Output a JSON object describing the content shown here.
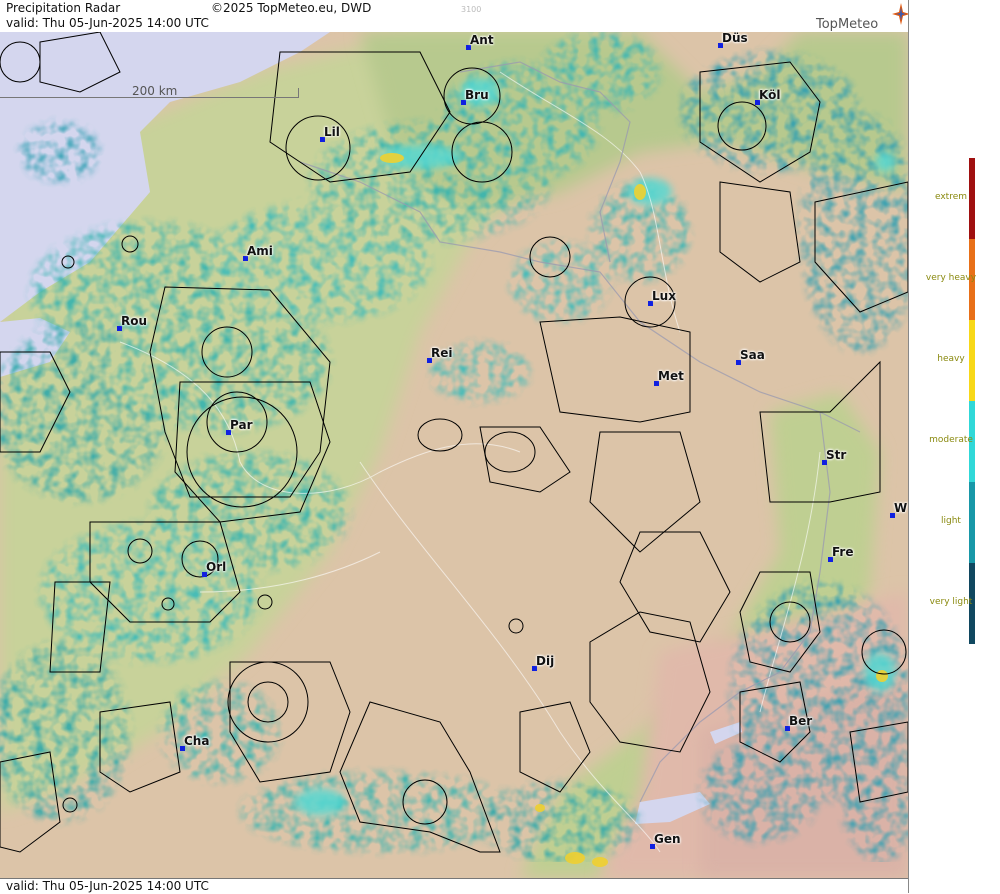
{
  "header": {
    "title": "Precipitation Radar",
    "copyright": "©2025 TopMeteo.eu, DWD",
    "valid": "valid:  Thu  05-Jun-2025 14:00 UTC",
    "faint_number": "3100"
  },
  "footer": {
    "valid": "valid:  Thu  05-Jun-2025 14:00 UTC"
  },
  "logo": {
    "text": "TopMeteo",
    "icon": "compass-star-icon"
  },
  "scale": {
    "label": "200 km"
  },
  "legend": [
    {
      "label": "extrem",
      "color": "#a01010"
    },
    {
      "label": "very heavy",
      "color": "#e87018"
    },
    {
      "label": "heavy",
      "color": "#f8d818"
    },
    {
      "label": "moderate",
      "color": "#30d8d8"
    },
    {
      "label": "light",
      "color": "#1898a8"
    },
    {
      "label": "very light",
      "color": "#104860"
    }
  ],
  "cities": [
    {
      "name": "Ant"
    },
    {
      "name": "Düs"
    },
    {
      "name": "Bru"
    },
    {
      "name": "Köl"
    },
    {
      "name": "Lil"
    },
    {
      "name": "Ami"
    },
    {
      "name": "Lux"
    },
    {
      "name": "Rou"
    },
    {
      "name": "Rei"
    },
    {
      "name": "Saa"
    },
    {
      "name": "Met"
    },
    {
      "name": "Par"
    },
    {
      "name": "Str"
    },
    {
      "name": "W"
    },
    {
      "name": "Fre"
    },
    {
      "name": "Orl"
    },
    {
      "name": "Dij"
    },
    {
      "name": "Ber"
    },
    {
      "name": "Cha"
    },
    {
      "name": "Gen"
    }
  ],
  "colors": {
    "sea": "#d4d6ee",
    "lowland": "#c9d39a",
    "hills": "#dfc0a6",
    "mountains": "#e6bfae",
    "radar_light": "#33b3b0",
    "radar_very_light": "#1f8f99",
    "radar_moderate": "#4fd2cf",
    "radar_heavy": "#f0d030"
  }
}
